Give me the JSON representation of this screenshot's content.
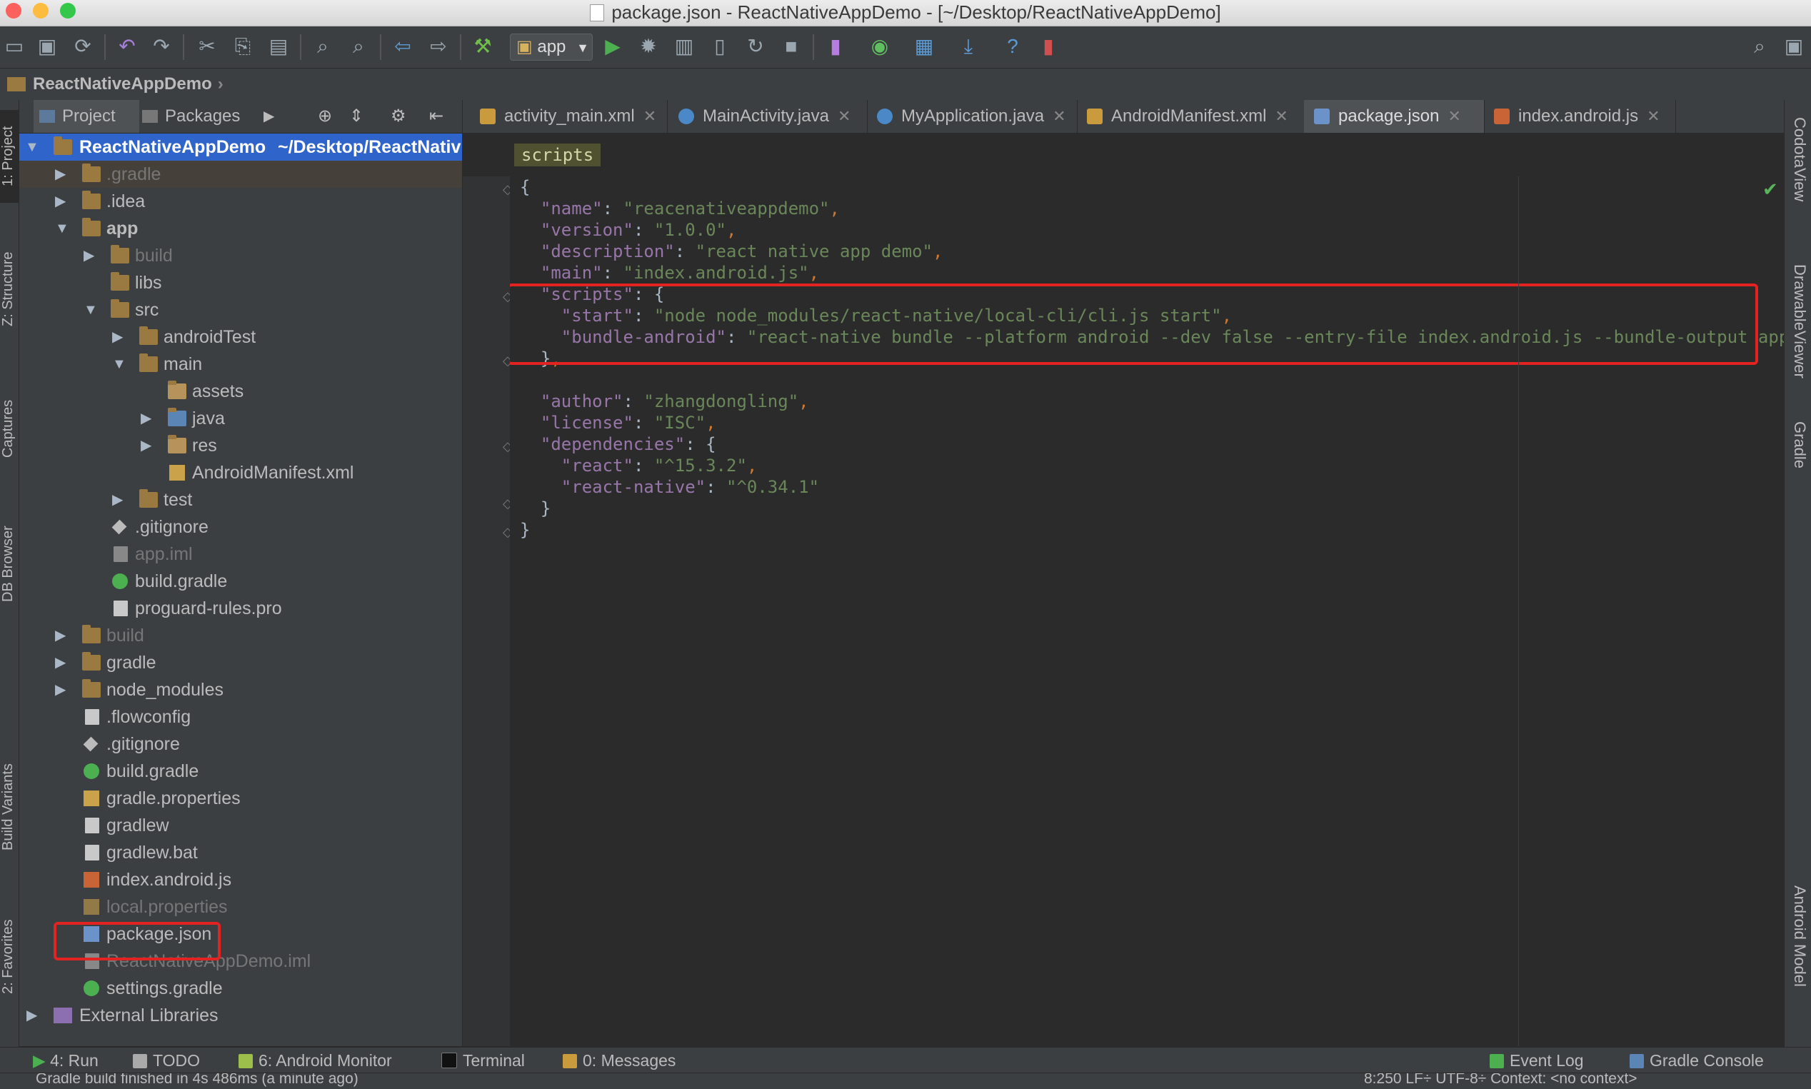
{
  "window": {
    "title": "package.json - ReactNativeAppDemo - [~/Desktop/ReactNativeAppDemo]",
    "colors": {
      "close": "#fc615d",
      "minimize": "#fdbc40",
      "maximize": "#34c84a"
    }
  },
  "toolbar": {
    "run_config": "app",
    "icons": [
      "open-folder-icon",
      "save-icon",
      "sync-icon",
      "undo-icon",
      "redo-icon",
      "cut-icon",
      "copy-icon",
      "paste-icon",
      "find-icon",
      "replace-icon",
      "back-icon",
      "forward-icon",
      "make-project-icon",
      "run-icon",
      "debug-icon",
      "profile-icon",
      "attach-debugger-icon",
      "apply-changes-icon",
      "stop-icon",
      "avd-manager-icon",
      "sync-gradle-icon",
      "project-structure-icon",
      "sdk-manager-icon",
      "help-icon",
      "device-monitor-icon",
      "search-everywhere-icon",
      "user-icon"
    ]
  },
  "navbar": {
    "breadcrumb": "ReactNativeAppDemo"
  },
  "left_strip": {
    "tabs": [
      "1: Project",
      "Z: Structure",
      "Captures",
      "DB Browser",
      "Build Variants",
      "2: Favorites"
    ]
  },
  "project_panel": {
    "tabs": [
      "Project",
      "Packages"
    ],
    "root_name": "ReactNativeAppDemo",
    "root_path": "~/Desktop/ReactNativ",
    "items": [
      {
        "label": ".gradle"
      },
      {
        "label": ".idea"
      },
      {
        "label": "app"
      },
      {
        "label": "build"
      },
      {
        "label": "libs"
      },
      {
        "label": "src"
      },
      {
        "label": "androidTest"
      },
      {
        "label": "main"
      },
      {
        "label": "assets"
      },
      {
        "label": "java"
      },
      {
        "label": "res"
      },
      {
        "label": "AndroidManifest.xml"
      },
      {
        "label": "test"
      },
      {
        "label": ".gitignore"
      },
      {
        "label": "app.iml"
      },
      {
        "label": "build.gradle"
      },
      {
        "label": "proguard-rules.pro"
      },
      {
        "label": "build"
      },
      {
        "label": "gradle"
      },
      {
        "label": "node_modules"
      },
      {
        "label": ".flowconfig"
      },
      {
        "label": ".gitignore"
      },
      {
        "label": "build.gradle"
      },
      {
        "label": "gradle.properties"
      },
      {
        "label": "gradlew"
      },
      {
        "label": "gradlew.bat"
      },
      {
        "label": "index.android.js"
      },
      {
        "label": "local.properties"
      },
      {
        "label": "package.json"
      },
      {
        "label": "ReactNativeAppDemo.iml"
      },
      {
        "label": "settings.gradle"
      },
      {
        "label": "External Libraries"
      }
    ]
  },
  "editor_tabs": [
    {
      "label": "activity_main.xml"
    },
    {
      "label": "MainActivity.java"
    },
    {
      "label": "MyApplication.java"
    },
    {
      "label": "AndroidManifest.xml"
    },
    {
      "label": "package.json"
    },
    {
      "label": "index.android.js"
    }
  ],
  "editor": {
    "breadcrumb_chip": "scripts",
    "lines": [
      "{",
      "  \"name\": \"reacenativeappdemo\",",
      "  \"version\": \"1.0.0\",",
      "  \"description\": \"react native app demo\",",
      "  \"main\": \"index.android.js\",",
      "  \"scripts\": {",
      "    \"start\": \"node node_modules/react-native/local-cli/cli.js start\",",
      "    \"bundle-android\": \"react-native bundle --platform android --dev false --entry-file index.android.js --bundle-output app/src",
      "  },",
      "",
      "  \"author\": \"zhangdongling\",",
      "  \"license\": \"ISC\",",
      "  \"dependencies\": {",
      "    \"react\": \"^15.3.2\",",
      "    \"react-native\": \"^0.34.1\"",
      "  }",
      "}"
    ]
  },
  "right_strip": {
    "tabs": [
      "CodotaView",
      "DrawableViewer",
      "Gradle",
      "Android Model"
    ]
  },
  "bottom_bar": {
    "left_tabs": [
      "4: Run",
      "TODO",
      "6: Android Monitor",
      "Terminal",
      "0: Messages"
    ],
    "right_tabs": [
      "Event Log",
      "Gradle Console"
    ]
  },
  "status_bar": {
    "message": "Gradle build finished in 4s 486ms (a minute ago)",
    "right": "8:250   LF÷   UTF-8÷   Context: <no context>"
  }
}
